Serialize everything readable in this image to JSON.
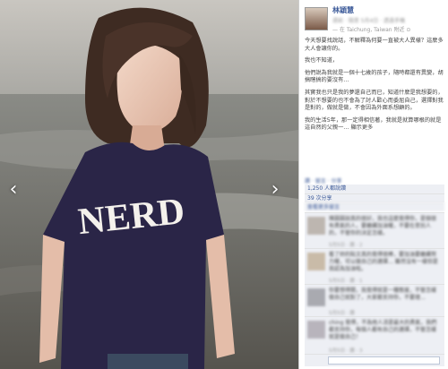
{
  "header": {
    "author": "林穎慧",
    "meta": "週前 · 隨意 5月4日 · 透過手機",
    "location": "— 在 Taichung, Taiwan 附近 ⊙"
  },
  "post": {
    "p1": "今天想要找說話，不解釋為何要一直被大人異樣？這麼多大人會讓你的。",
    "p2": "我也不知道，",
    "p3": "他們說為我就是一個十七歲的孩子，隨時都還有異變，胡搞瞎搞的要沒有…",
    "p4": "其實我也只是我的夢還自己而已，知道什麼是我想要的，對於不想要的也不會為了討人歡心而委屈自己，選擇對我是對的，做就是做，不會因為外面系想顧的。",
    "p5": "我的生活5年，那一定得相信著，我就是就算哪根的就是這自然的父親一… 顯示更多",
    "p5_link": "顯示更多"
  },
  "actions": "讚 · 留言 · 分享",
  "likes": "1,250 人都說讚",
  "shares": "39 次分享",
  "view_more": "查看更多留言",
  "comments": [
    {
      "text": "陳圓圓說真的很好，我也這麼覺得你，是個很有勇氣的人，要繼續加油喔，不要在意別人的，不管你的決定怎樣。",
      "meta": "5月5日 · 讚 · 2"
    },
    {
      "text": "看了妳的貼文真的覺得很棒，要加油要繼續努力喔，可以做自己的選擇… 雖然沒有一樣但是我認為加油啦。",
      "meta": "5月5日 · 讚 · 1"
    },
    {
      "text": "你要想得開，我覺得就是一種態度，不管怎樣做自己就對了，大家都支持你，不要理…",
      "meta": "5月5日 · 讚"
    },
    {
      "text": "ching 覺得，不為他人活是最大的勇氣，我們都支持你，每個人都有自己的選擇，不管怎樣就是做自己！",
      "meta": "5月5日 · 讚 · 3"
    }
  ],
  "photo": {
    "shirt_text": "NERD"
  },
  "nav": {
    "prev": "‹",
    "next": "›"
  }
}
